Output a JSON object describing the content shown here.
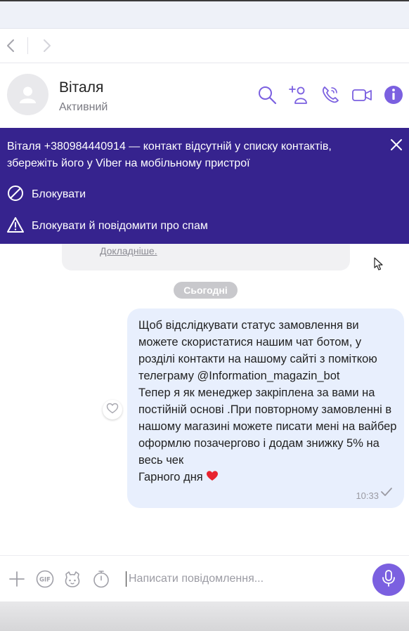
{
  "navigation": {
    "back": "back",
    "forward": "forward"
  },
  "contact": {
    "name": "Віталя",
    "status": "Активний"
  },
  "banner": {
    "message": "Віталя +380984440914 — контакт відсутній у списку контактів, збережіть його у Viber на мобільному пристрої",
    "block_label": "Блокувати",
    "block_spam_label": "Блокувати й повідомити про спам"
  },
  "chat": {
    "previous_link": "Докладніше.",
    "date_separator": "Сьогодні",
    "message": {
      "text": "Щоб відслідкувати статус замовлення ви можете скористатися нашим чат ботом, у розділі контакти на нашому сайті з поміткою телеграму @Information_magazin_bot\nТепер я як менеджер закріплена за вами на постійній основі .При повторному замовленні в нашому магазині можете писати мені на вайбер оформлю позачергово і додам знижку 5% на весь чек\nГарного дня",
      "emoji": "heart",
      "time": "10:33",
      "status": "delivered"
    }
  },
  "composer": {
    "placeholder": "Написати повідомлення..."
  },
  "colors": {
    "accent": "#7b60e0",
    "banner": "#36238e",
    "bubble": "#e8effd",
    "icon": "#7b60e0"
  },
  "icons": [
    "back-arrow-icon",
    "forward-arrow-icon",
    "search-icon",
    "add-contact-icon",
    "phone-icon",
    "video-icon",
    "info-icon",
    "close-icon",
    "block-icon",
    "warning-icon",
    "plus-icon",
    "gif-icon",
    "sticker-icon",
    "timer-icon",
    "mic-icon",
    "like-icon",
    "check-icon"
  ]
}
